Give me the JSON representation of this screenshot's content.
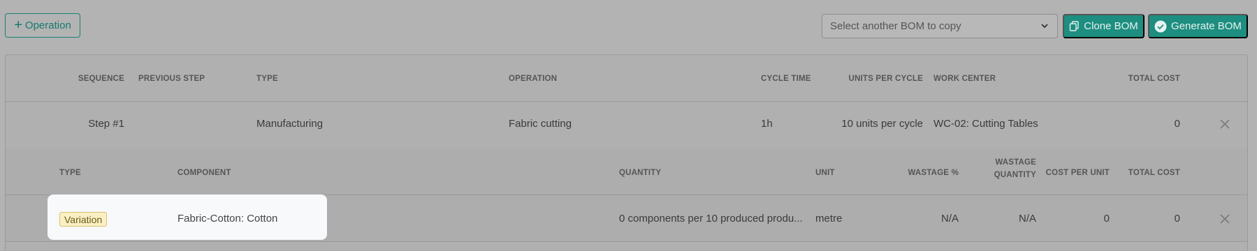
{
  "toolbar": {
    "add_operation_label": "Operation",
    "bom_select_placeholder": "Select another BOM to copy",
    "clone_label": "Clone BOM",
    "generate_label": "Generate BOM"
  },
  "operations_table": {
    "headers": {
      "sequence": "SEQUENCE",
      "previous_step": "PREVIOUS STEP",
      "type": "TYPE",
      "operation": "OPERATION",
      "cycle_time": "CYCLE TIME",
      "units_per_cycle": "UNITS PER CYCLE",
      "work_center": "WORK CENTER",
      "total_cost": "TOTAL COST"
    },
    "rows": [
      {
        "sequence": "Step #1",
        "previous_step": "",
        "type": "Manufacturing",
        "operation": "Fabric cutting",
        "cycle_time": "1h",
        "units_per_cycle": "10 units per cycle",
        "work_center": "WC-02: Cutting Tables",
        "total_cost": "0"
      }
    ]
  },
  "components_table": {
    "headers": {
      "type": "TYPE",
      "component": "COMPONENT",
      "quantity": "QUANTITY",
      "unit": "UNIT",
      "wastage_pct": "WASTAGE %",
      "wastage_qty_line1": "WASTAGE",
      "wastage_qty_line2": "QUANTITY",
      "cost_per_unit": "COST PER UNIT",
      "total_cost": "TOTAL COST"
    },
    "rows": [
      {
        "type": "Variation",
        "component": "Fabric-Cotton: Cotton",
        "quantity": "0 components per 10 produced produ...",
        "unit": "metre",
        "wastage_pct": "N/A",
        "wastage_qty": "N/A",
        "cost_per_unit": "0",
        "total_cost": "0"
      }
    ]
  },
  "colors": {
    "accent": "#1d8e80",
    "overlay": "#b3b3b3",
    "badge_bg": "#fbf0c4",
    "highlight_bg": "#f8f9fb"
  }
}
